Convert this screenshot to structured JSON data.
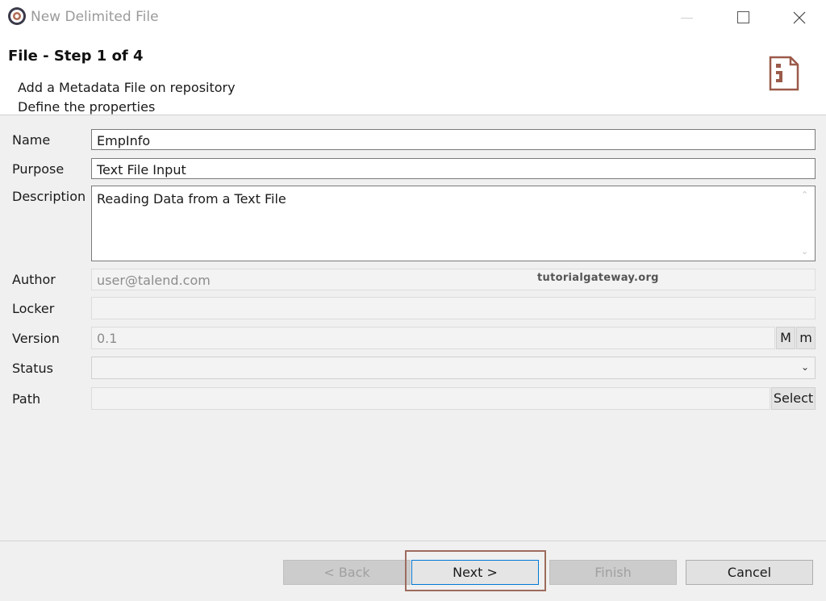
{
  "window": {
    "title": "New Delimited File"
  },
  "header": {
    "step_title": "File - Step 1 of 4",
    "line1": "Add a Metadata File on repository",
    "line2": "Define the properties"
  },
  "form": {
    "name": {
      "label": "Name",
      "value": "EmpInfo"
    },
    "purpose": {
      "label": "Purpose",
      "value": "Text File Input"
    },
    "description": {
      "label": "Description",
      "value": "Reading Data from a Text File"
    },
    "author": {
      "label": "Author",
      "value": "user@talend.com"
    },
    "locker": {
      "label": "Locker",
      "value": ""
    },
    "version": {
      "label": "Version",
      "value": "0.1",
      "major_button": "M",
      "minor_button": "m"
    },
    "status": {
      "label": "Status",
      "value": ""
    },
    "path": {
      "label": "Path",
      "value": "",
      "select_button": "Select"
    }
  },
  "watermark": "tutorialgateway.org",
  "footer": {
    "back_label": "< Back",
    "next_label": "Next >",
    "finish_label": "Finish",
    "cancel_label": "Cancel"
  },
  "colors": {
    "highlight": "#9e6b5d",
    "icon_accent": "#9b5a4a"
  }
}
